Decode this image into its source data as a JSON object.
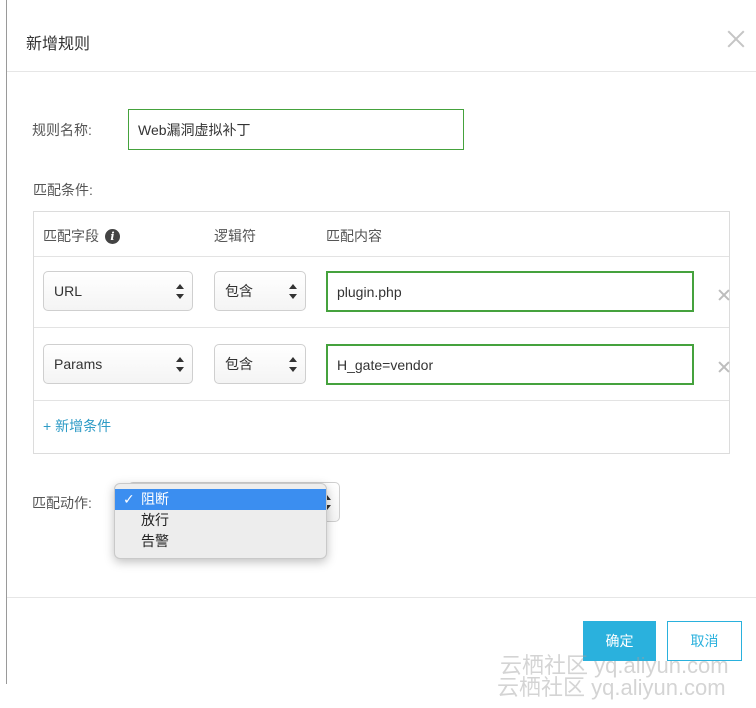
{
  "dialog": {
    "title": "新增规则"
  },
  "form": {
    "rule_name_label": "规则名称:",
    "rule_name_value": "Web漏洞虚拟补丁",
    "match_conditions_label": "匹配条件:",
    "match_action_label": "匹配动作:"
  },
  "conditions": {
    "headers": {
      "field": "匹配字段",
      "operator": "逻辑符",
      "content": "匹配内容"
    },
    "info_icon": "i",
    "rows": [
      {
        "field": "URL",
        "operator": "包含",
        "content": "plugin.php"
      },
      {
        "field": "Params",
        "operator": "包含",
        "content": "H_gate=vendor"
      }
    ],
    "add_label": "+ 新增条件"
  },
  "action_dropdown": {
    "options": [
      {
        "label": "阻断",
        "selected": true
      },
      {
        "label": "放行",
        "selected": false
      },
      {
        "label": "告警",
        "selected": false
      }
    ],
    "check_mark": "✓"
  },
  "footer": {
    "ok_label": "确定",
    "cancel_label": "取消"
  },
  "watermark": {
    "text": "云栖社区 yq.aliyun.com"
  },
  "colors": {
    "accent": "#2ab1dd",
    "valid_border": "#45a23d",
    "dropdown_highlight": "#3b8ef0",
    "link": "#2e9bc6"
  },
  "icons": {
    "close": "close-icon",
    "row_remove": "close-icon",
    "info": "info-icon",
    "select_arrows": "chevron-up-down-icon",
    "check": "check-icon"
  }
}
